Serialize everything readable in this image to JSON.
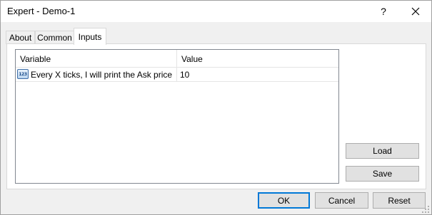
{
  "window": {
    "title": "Expert - Demo-1",
    "help_label": "?",
    "close_icon": "close-icon"
  },
  "tabs": [
    {
      "label": "About",
      "active": false
    },
    {
      "label": "Common",
      "active": false
    },
    {
      "label": "Inputs",
      "active": true
    }
  ],
  "inputs_table": {
    "columns": [
      "Variable",
      "Value"
    ],
    "rows": [
      {
        "icon": "integer-icon",
        "icon_text": "123",
        "variable": "Every X ticks, I will print the Ask price",
        "value": "10"
      }
    ]
  },
  "side_buttons": {
    "load_label": "Load",
    "save_label": "Save"
  },
  "footer_buttons": {
    "ok_label": "OK",
    "cancel_label": "Cancel",
    "reset_label": "Reset"
  },
  "colors": {
    "accent": "#0078d7",
    "window_bg": "#f0f0f0"
  }
}
